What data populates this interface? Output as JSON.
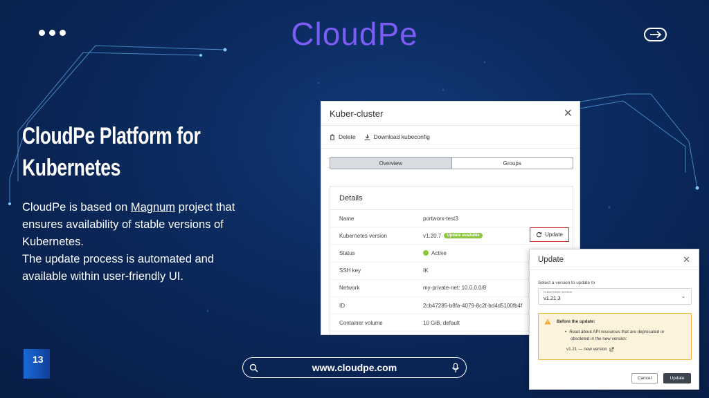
{
  "header": {
    "brand": "CloudPe"
  },
  "slide": {
    "title_line1": "CloudPe Platform for",
    "title_line2": "Kubernetes",
    "body_line1_pre": "CloudPe is based on ",
    "body_line1_link": "Magnum",
    "body_line1_post": " project that",
    "body_line2": "ensures availability of stable versions of",
    "body_line3": "Kubernetes.",
    "body_line4": "The update process is automated and",
    "body_line5": "available within user-friendly UI.",
    "page_number": "13"
  },
  "footer": {
    "url": "www.cloudpe.com"
  },
  "panel": {
    "title": "Kuber-cluster",
    "actions": {
      "delete": "Delete",
      "download": "Download kubeconfig"
    },
    "tabs": [
      "Overview",
      "Groups"
    ],
    "details_title": "Details",
    "rows": [
      {
        "key": "Name",
        "value": "portworx-test3"
      },
      {
        "key": "Kubernetes version",
        "value": "v1.20.7",
        "badge": "Update available"
      },
      {
        "key": "Status",
        "value": "Active"
      },
      {
        "key": "SSH key",
        "value": "IK"
      },
      {
        "key": "Network",
        "value": "my-private-net: 10.0.0.0/8"
      },
      {
        "key": "ID",
        "value": "2cb47285-b8fa-4079-8c2f-bd4d5100fb4f"
      },
      {
        "key": "Container volume",
        "value": "10 GiB, default"
      }
    ],
    "update_button": "Update"
  },
  "dialog": {
    "title": "Update",
    "select_label": "Select a version to update to",
    "field_label": "Kubernetes version",
    "field_value": "v1.21.3",
    "warning_title": "Before the update:",
    "warning_text_1": "Read about API resources that are deprecated or",
    "warning_text_2": "obsoleted in the new version:",
    "warning_link": "v1.21 — new version",
    "cancel": "Cancel",
    "confirm": "Update"
  }
}
